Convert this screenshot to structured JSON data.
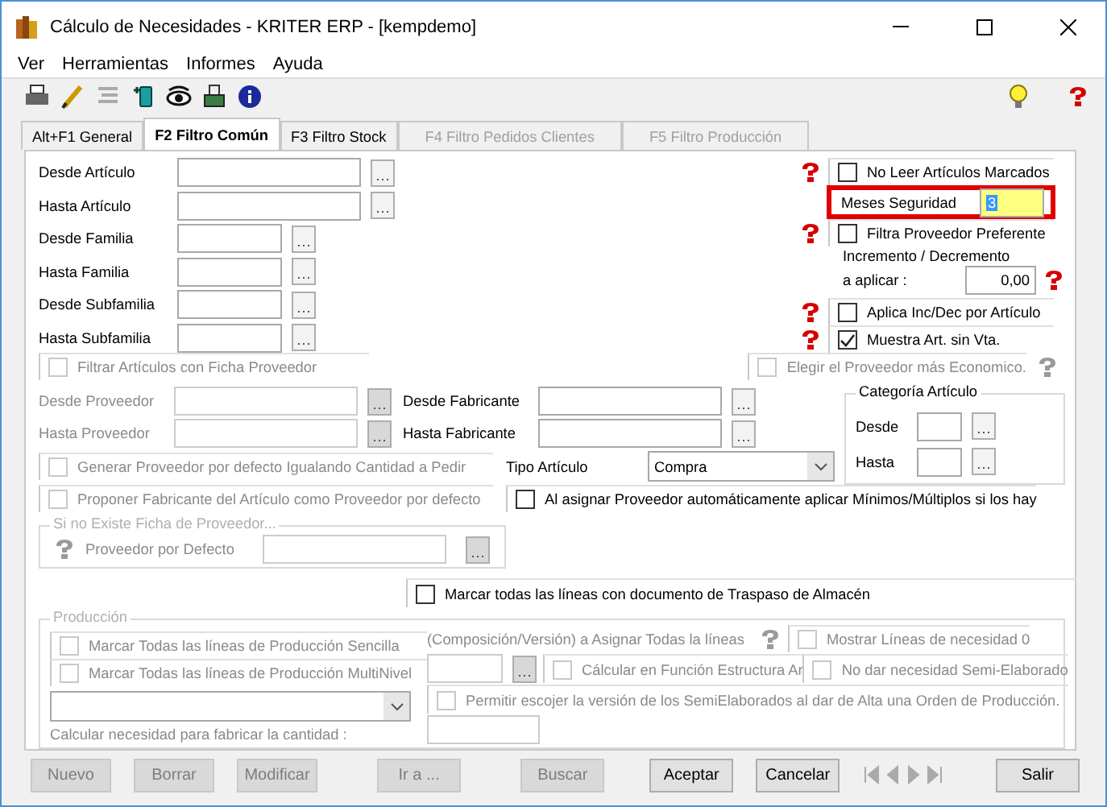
{
  "window": {
    "title": "Cálculo de Necesidades - KRITER ERP - [kempdemo]"
  },
  "menu": [
    "Ver",
    "Herramientas",
    "Informes",
    "Ayuda"
  ],
  "tabs": [
    {
      "label": "Alt+F1 General",
      "selected": false,
      "disabled": false
    },
    {
      "label": "F2 Filtro Común",
      "selected": true,
      "disabled": false
    },
    {
      "label": "F3 Filtro Stock",
      "selected": false,
      "disabled": false
    },
    {
      "label": "F4 Filtro Pedidos Clientes",
      "selected": false,
      "disabled": true
    },
    {
      "label": "F5 Filtro Producción",
      "selected": false,
      "disabled": true
    }
  ],
  "filters": [
    {
      "label": "Desde Artículo",
      "kind": "wide"
    },
    {
      "label": "Hasta Artículo",
      "kind": "wide"
    },
    {
      "label": "Desde Familia",
      "kind": "narrow"
    },
    {
      "label": "Hasta Familia",
      "kind": "narrow"
    },
    {
      "label": "Desde Subfamilia",
      "kind": "narrow"
    },
    {
      "label": "Hasta Subfamilia",
      "kind": "narrow"
    }
  ],
  "options": [
    {
      "kind": "checkbox",
      "label": "No Leer Artículos Marcados",
      "checked": false
    },
    {
      "kind": "field",
      "label": "Meses Seguridad",
      "value": "3",
      "highlighted": true
    },
    {
      "kind": "checkbox",
      "label": "Filtra Proveedor Preferente",
      "checked": false
    },
    {
      "kind": "group",
      "title": "Incremento / Decremento",
      "label": "a aplicar :",
      "value": "0,00"
    },
    {
      "kind": "checkbox",
      "label": "Aplica Inc/Dec por Artículo",
      "checked": false
    },
    {
      "kind": "checkbox",
      "label": "Muestra Art. sin Vta.",
      "checked": true
    }
  ],
  "supplier_filter": {
    "label": "Filtrar Artículos con Ficha Proveedor",
    "checked": false,
    "disabled": true
  },
  "cheapest_supplier": {
    "label": "Elegir el Proveedor más Economico.",
    "checked": false,
    "disabled": true
  },
  "supplier_ranges": [
    {
      "label": "Desde Proveedor",
      "disabled": true
    },
    {
      "label": "Hasta Proveedor",
      "disabled": true
    }
  ],
  "manufacturer_ranges": [
    {
      "label": "Desde Fabricante"
    },
    {
      "label": "Hasta Fabricante"
    }
  ],
  "category": {
    "title": "Categoría Artículo",
    "rows": [
      "Desde",
      "Hasta"
    ]
  },
  "supplier_options": [
    {
      "label": "Generar Proveedor por defecto Igualando Cantidad a Pedir",
      "checked": false,
      "disabled": true
    },
    {
      "label": "Proponer Fabricante del Artículo como Proveedor por defecto",
      "checked": false,
      "disabled": true
    }
  ],
  "article_type": {
    "label": "Tipo Artículo",
    "value": "Compra"
  },
  "min_multiples": {
    "label": "Al asignar Proveedor automáticamente aplicar Mínimos/Múltiplos si los hay",
    "checked": false,
    "disabled": false
  },
  "default_supplier": {
    "title": "Si no Existe Ficha de Proveedor...",
    "label": "Proveedor por Defecto",
    "disabled": true
  },
  "transfer": {
    "label": "Marcar todas las líneas con documento de Traspaso de Almacén",
    "checked": false,
    "disabled": false
  },
  "production": {
    "title": "Producción",
    "disabled": true,
    "mark_options": [
      {
        "label": "Marcar Todas las líneas de Producción Sencilla",
        "checked": false
      },
      {
        "label": "Marcar Todas las líneas de Producción MultiNivel",
        "checked": false
      }
    ],
    "composition_label": "(Composición/Versión) a Asignar Todas la líneas",
    "structure": {
      "label": "Cálcular en Función Estructura Ar",
      "checked": false
    },
    "right_options": [
      {
        "label": "Mostrar Líneas de necesidad 0",
        "checked": false
      },
      {
        "label": "No dar necesidad Semi-Elaborado",
        "checked": false
      }
    ],
    "allow_version": {
      "label": "Permitir escojer la versión de los SemiElaborados al dar de Alta una Orden de Producción.",
      "checked": false
    },
    "quantity_label": "Calcular necesidad para fabricar la cantidad :"
  },
  "record_buttons": [
    {
      "label": "Nuevo",
      "disabled": true
    },
    {
      "label": "Borrar",
      "disabled": true
    },
    {
      "label": "Modificar",
      "disabled": true
    }
  ],
  "goto_button": {
    "label": "Ir a ...",
    "disabled": true
  },
  "search_button": {
    "label": "Buscar",
    "disabled": true
  },
  "dialog_buttons": [
    {
      "label": "Aceptar",
      "disabled": false
    },
    {
      "label": "Cancelar",
      "disabled": false
    }
  ],
  "exit_button": {
    "label": "Salir",
    "disabled": false
  }
}
